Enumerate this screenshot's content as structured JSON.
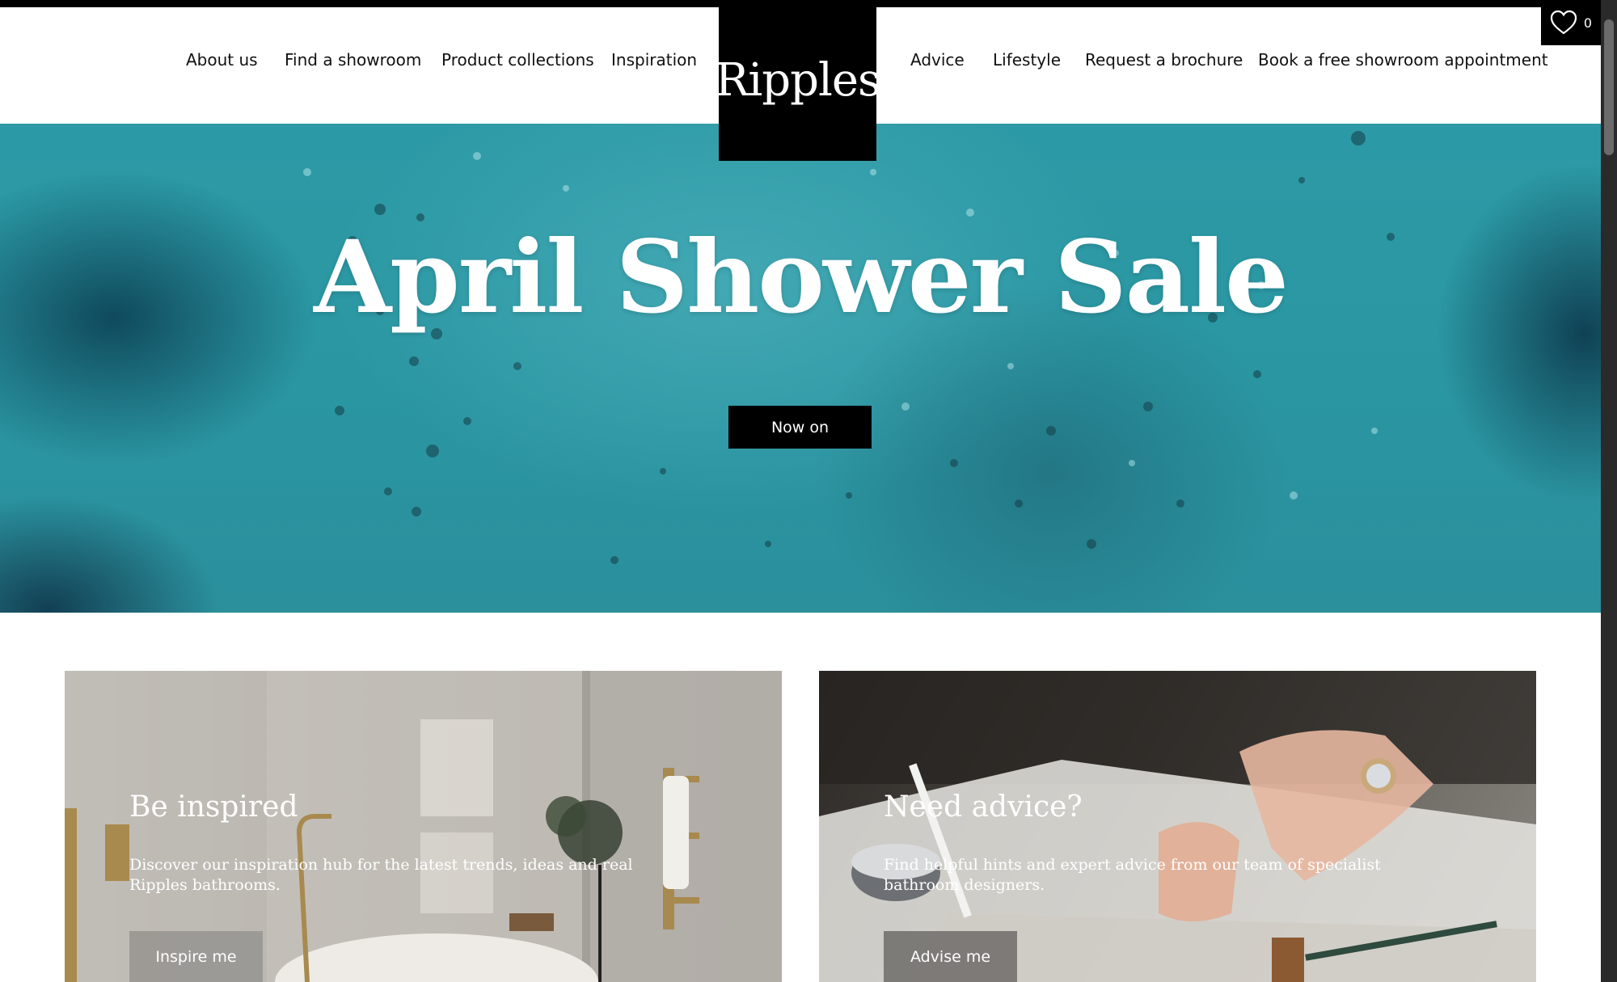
{
  "nav": {
    "left": [
      "About us",
      "Find a showroom",
      "Product collections",
      "Inspiration"
    ],
    "right": [
      "Advice",
      "Lifestyle",
      "Request a brochure",
      "Book a free showroom appointment"
    ]
  },
  "logo": {
    "text": "Ripples"
  },
  "wishlist": {
    "icon": "heart-icon",
    "count": "0"
  },
  "hero": {
    "title": "April Shower Sale",
    "button": "Now on"
  },
  "cards": [
    {
      "title": "Be inspired",
      "text": "Discover our inspiration hub for the latest trends, ideas and real Ripples bathrooms.",
      "button": "Inspire me"
    },
    {
      "title": "Need advice?",
      "text": "Find helpful hints and expert advice from our team of specialist bathroom designers.",
      "button": "Advise me"
    }
  ],
  "colors": {
    "hero_teal": "#2c9aa6",
    "brand_black": "#000000"
  }
}
